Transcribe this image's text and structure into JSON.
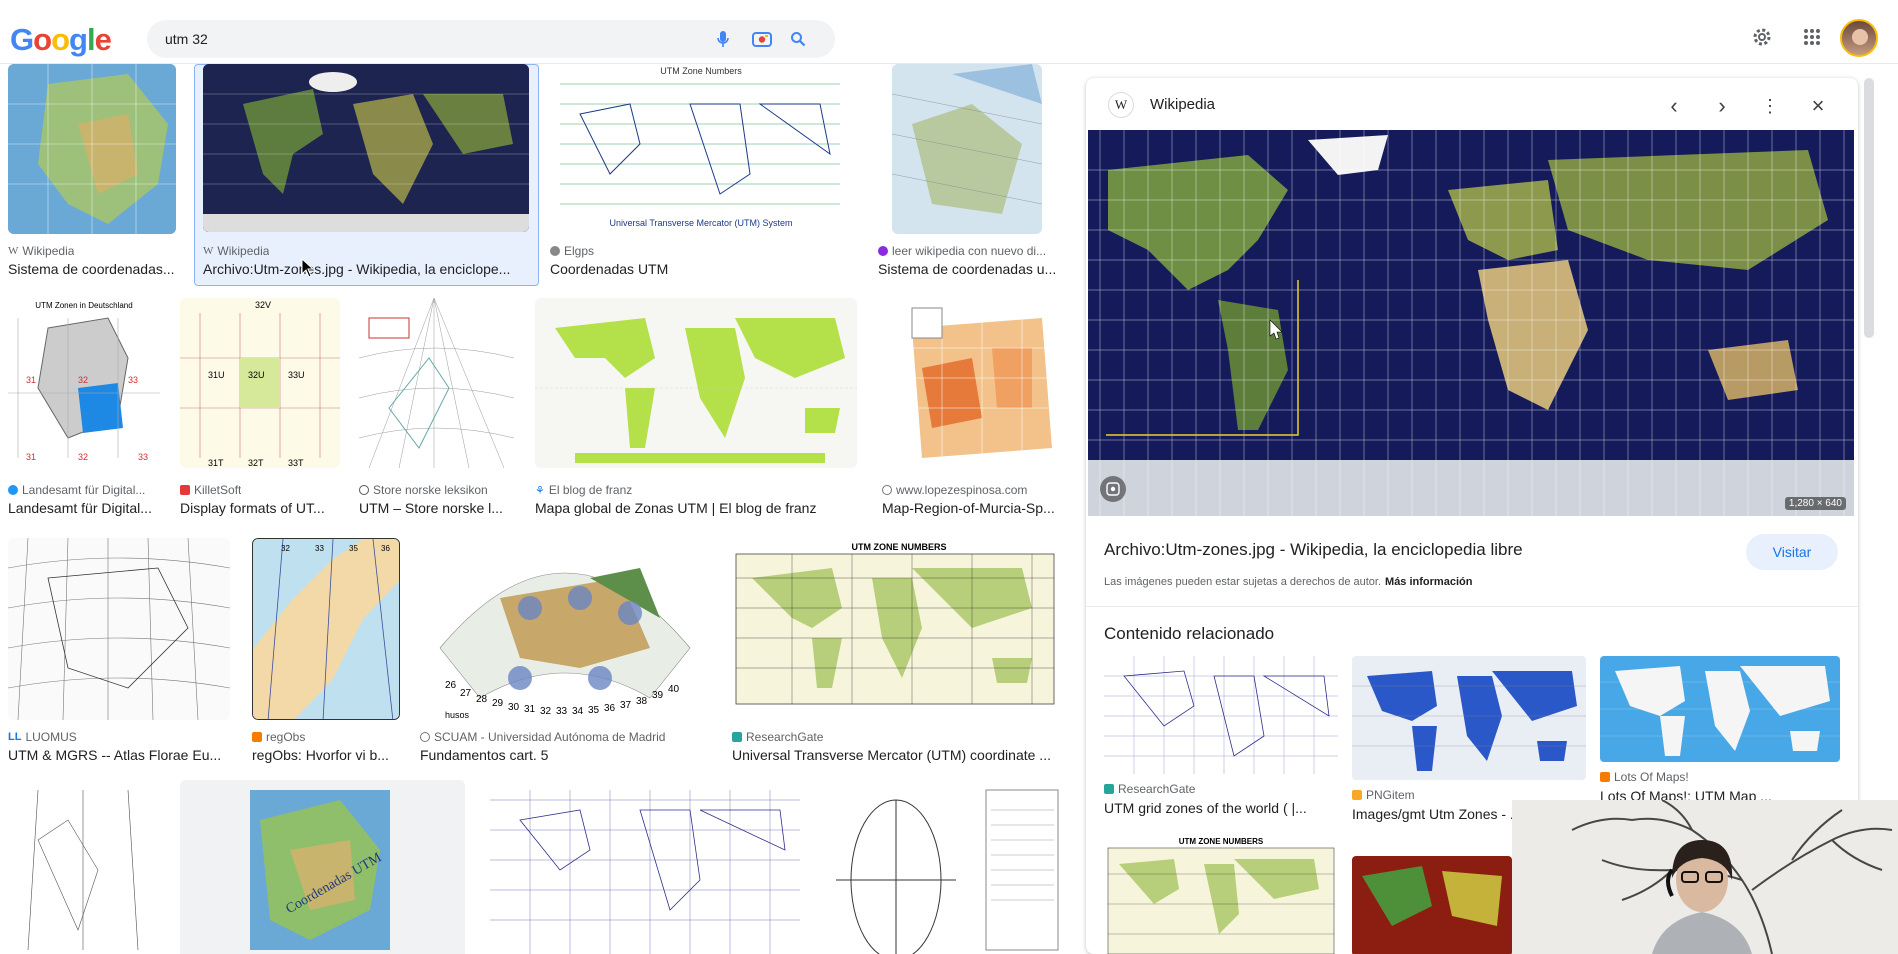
{
  "search": {
    "query": "utm 32",
    "placeholder": ""
  },
  "logo": {
    "text": [
      "G",
      "o",
      "o",
      "g",
      "l",
      "e"
    ]
  },
  "icons": {
    "mic": "mic-icon",
    "lens": "camera-icon",
    "search": "search-icon",
    "settings": "gear-icon",
    "apps": "apps-icon"
  },
  "colors": {
    "blue": "#4285f4",
    "red": "#ea4335",
    "yellow": "#fbbc05",
    "green": "#34a853",
    "accent": "#1a73e8"
  },
  "results": [
    {
      "source": "Wikipedia",
      "title": "Sistema de coordenadas..."
    },
    {
      "source": "Wikipedia",
      "title": "Archivo:Utm-zones.jpg - Wikipedia, la enciclope..."
    },
    {
      "source": "Elgps",
      "title": "Coordenadas UTM"
    },
    {
      "source": "leer wikipedia con nuevo di...",
      "title": "Sistema de coordenadas u..."
    },
    {
      "source": "Landesamt für Digital...",
      "title": "Landesamt für Digital..."
    },
    {
      "source": "KilletSoft",
      "title": "Display formats of UT..."
    },
    {
      "source": "Store norske leksikon",
      "title": "UTM – Store norske l..."
    },
    {
      "source": "El blog de franz",
      "title": "Mapa global de Zonas UTM | El blog de franz"
    },
    {
      "source": "www.lopezespinosa.com",
      "title": "Map-Region-of-Murcia-Sp..."
    },
    {
      "source": "LUOMUS",
      "title": "UTM & MGRS -- Atlas Florae Eu..."
    },
    {
      "source": "regObs",
      "title": "regObs: Hvorfor vi b..."
    },
    {
      "source": "SCUAM - Universidad Autónoma de Madrid",
      "title": "Fundamentos cart. 5"
    },
    {
      "source": "ResearchGate",
      "title": "Universal Transverse Mercator (UTM) coordinate ..."
    }
  ],
  "thumb_text": {
    "utm_zone_numbers": "UTM Zone Numbers",
    "utm_system": "Universal Transverse Mercator (UTM) System",
    "utm_deutschland": "UTM Zonen in Deutschland",
    "utm_zone_numbers_caps": "UTM ZONE NUMBERS",
    "coordenadas_utm": "Coordenadas UTM",
    "zone_labels": [
      "31",
      "32",
      "33",
      "31",
      "32",
      "33"
    ],
    "zone_32v": "32V",
    "zone_grid": [
      "31U",
      "32U",
      "33U",
      "31T",
      "32T",
      "33T"
    ],
    "fan_numbers": [
      "26",
      "27",
      "28",
      "29",
      "30",
      "31",
      "32",
      "33",
      "34",
      "35",
      "36",
      "37",
      "38",
      "39",
      "40"
    ],
    "husos": "husos",
    "norway_cols": [
      "32",
      "33",
      "35",
      "36"
    ],
    "wiki_w": "W"
  },
  "panel": {
    "site": "Wikipedia",
    "image_dims": "1,280 × 640",
    "title": "Archivo:Utm-zones.jpg - Wikipedia, la enciclopedia libre",
    "note": "Las imágenes pueden estar sujetas a derechos de autor.",
    "more_info": "Más información",
    "visit": "Visitar",
    "related_heading": "Contenido relacionado",
    "related": [
      {
        "source": "ResearchGate",
        "title": "UTM grid zones of the world ( |..."
      },
      {
        "source": "PNGitem",
        "title": "Images/gmt Utm Zones - ..."
      },
      {
        "source": "Lots Of Maps!",
        "title": "Lots Of Maps!: UTM Map ..."
      }
    ]
  }
}
